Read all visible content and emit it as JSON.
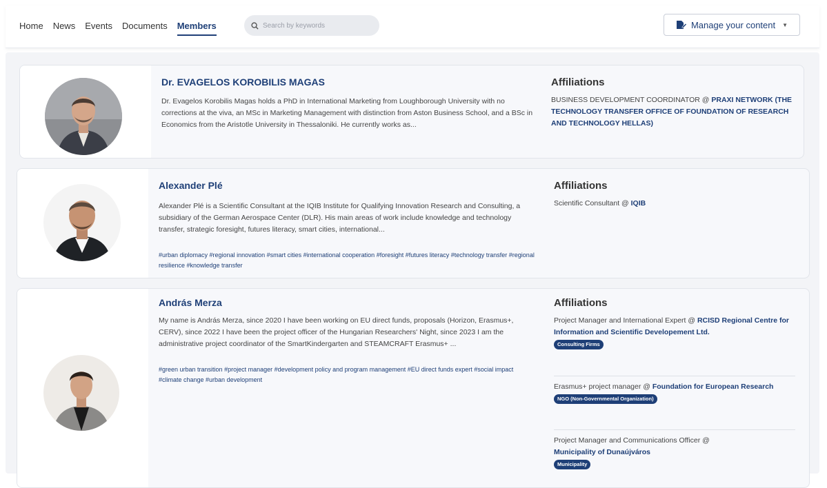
{
  "nav": {
    "items": [
      "Home",
      "News",
      "Events",
      "Documents",
      "Members"
    ],
    "active_index": 4
  },
  "search": {
    "placeholder": "Search by keywords"
  },
  "manage_button": {
    "label": "Manage your content",
    "icon": "document-edit-icon"
  },
  "members": [
    {
      "name": "Dr. EVAGELOS KOROBILIS MAGAS",
      "bio": "Dr. Evagelos Korobilis Magas holds a PhD in International Marketing from Loughborough University with no corrections at the viva, an MSc in Marketing Management with distinction from Aston Business School, and a BSc in Economics from the Aristotle University in Thessaloniki. He currently works as...",
      "tags": "",
      "affiliations_title": "Affiliations",
      "affiliations": [
        {
          "role": "BUSINESS DEVELOPMENT COORDINATOR @ ",
          "org": "PRAXI NETWORK (THE TECHNOLOGY TRANSFER OFFICE OF FOUNDATION OF RESEARCH AND TECHNOLOGY HELLAS)",
          "badge": ""
        }
      ]
    },
    {
      "name": "Alexander Plé",
      "bio": "Alexander Plé is a Scientific Consultant at the IQIB Institute for Qualifying Innovation Research and Consulting, a subsidiary of the German Aerospace Center (DLR). His main areas of work include knowledge and technology transfer, strategic foresight, futures literacy, smart cities, international...",
      "tags": "#urban diplomacy #regional innovation #smart cities #international cooperation #foresight #futures literacy #technology transfer #regional resilience #knowledge transfer",
      "affiliations_title": "Affiliations",
      "affiliations": [
        {
          "role": "Scientific Consultant @ ",
          "org": "IQIB",
          "badge": ""
        }
      ]
    },
    {
      "name": "András Merza",
      "bio": "My name is András Merza, since 2020 I have been working on EU direct funds, proposals (Horizon, Erasmus+, CERV), since 2022 I have been the project officer of the Hungarian Researchers' Night, since 2023 I am the administrative project coordinator of the SmartKindergarten and STEAMCRAFT Erasmus+ ...",
      "tags": "#green urban transition #project manager #development policy and program management #EU direct funds expert #social impact #climate change #urban development",
      "affiliations_title": "Affiliations",
      "affiliations": [
        {
          "role": "Project Manager and International Expert @ ",
          "org": "RCISD Regional Centre for Information and Scientific Developement Ltd.",
          "badge": "Consulting Firms"
        },
        {
          "role": "Erasmus+ project manager @ ",
          "org": "Foundation for European Research",
          "badge": "NGO (Non-Governmental Organization)"
        },
        {
          "role": "Project Manager and Communications Officer @ ",
          "org": "Municipality of Dunaújváros",
          "badge": "Municipality"
        }
      ]
    }
  ],
  "colors": {
    "brand": "#1e3f77",
    "card_bg": "#f7f8fb",
    "page_bg": "#f3f4f7"
  }
}
